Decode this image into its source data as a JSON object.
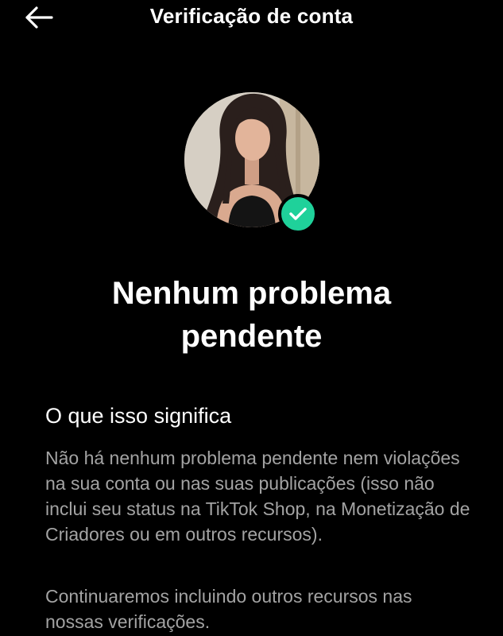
{
  "header": {
    "title": "Verificação de conta",
    "back_icon": "arrow-left-icon"
  },
  "profile": {
    "avatar": "profile-photo",
    "badge_icon": "check-icon",
    "badge_color": "#1fd19a"
  },
  "main": {
    "title_line1": "Nenhum problema",
    "title_line2": "pendente",
    "section_heading": "O que isso significa",
    "paragraph1": "Não há nenhum problema pendente nem violações na sua conta ou nas suas publicações (isso não inclui seu status na TikTok Shop, na Monetização de Criadores ou em outros recursos).",
    "paragraph2": "Continuaremos incluindo outros recursos nas nossas verificações."
  },
  "colors": {
    "background": "#000000",
    "text_primary": "#ffffff",
    "text_secondary": "#a3a3a3"
  }
}
